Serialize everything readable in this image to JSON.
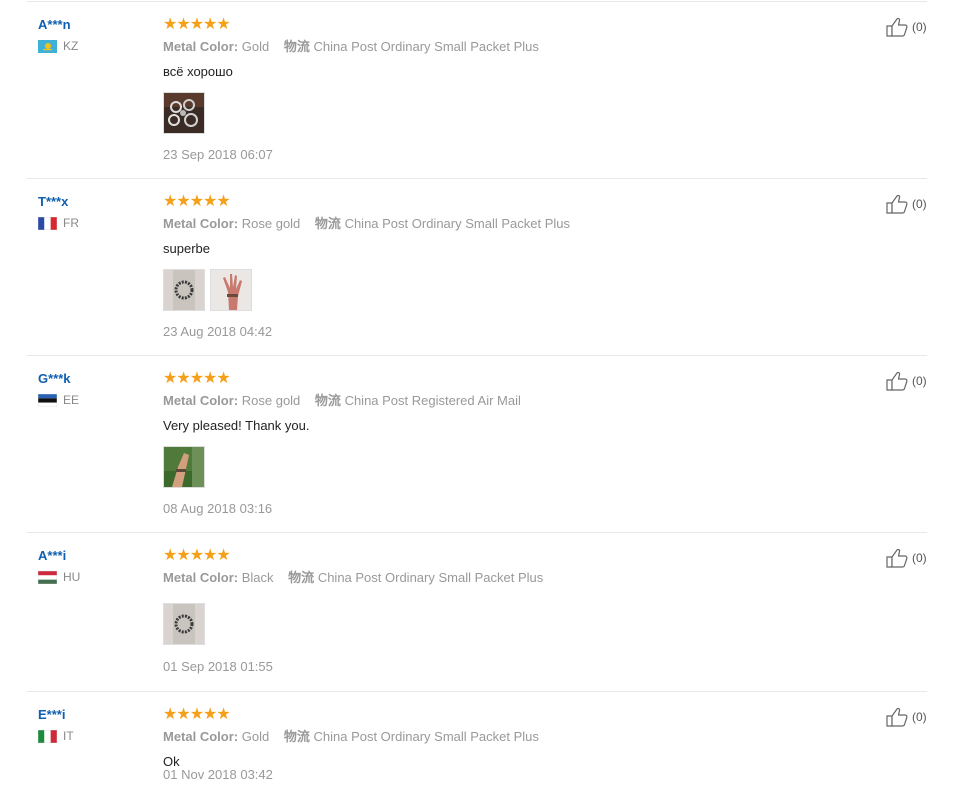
{
  "labels": {
    "metal_color": "Metal Color:",
    "logistics": "物流"
  },
  "stars": "★★★★★",
  "reviews": [
    {
      "user": "A***n",
      "country": "KZ",
      "flag_colors": [
        "#3fb0d8",
        "#f2c21a"
      ],
      "metal_color": "Gold",
      "logistics": "China Post Ordinary Small Packet Plus",
      "feedback": "всё хорошо",
      "photos": [
        "buyer-photo-bracelets"
      ],
      "date": "23 Sep 2018 06:07",
      "helpful": "(0)"
    },
    {
      "user": "T***x",
      "country": "FR",
      "flag_colors": [
        "#2b4aa8",
        "#ffffff",
        "#d7282f"
      ],
      "metal_color": "Rose gold",
      "logistics": "China Post Ordinary Small Packet Plus",
      "feedback": "superbe",
      "photos": [
        "buyer-photo-bracelet",
        "buyer-photo-hand"
      ],
      "date": "23 Aug 2018 04:42",
      "helpful": "(0)"
    },
    {
      "user": "G***k",
      "country": "EE",
      "flag_colors": [
        "#2a63b5",
        "#111111",
        "#ffffff"
      ],
      "metal_color": "Rose gold",
      "logistics": "China Post Registered Air Mail",
      "feedback": "Very pleased! Thank you.",
      "photos": [
        "buyer-photo-wrist"
      ],
      "date": "08 Aug 2018 03:16",
      "helpful": "(0)"
    },
    {
      "user": "A***i",
      "country": "HU",
      "flag_colors": [
        "#cd2a3e",
        "#ffffff",
        "#436f4d"
      ],
      "metal_color": "Black",
      "logistics": "China Post Ordinary Small Packet Plus",
      "feedback": "",
      "photos": [
        "buyer-photo-bracelet"
      ],
      "date": "01 Sep 2018 01:55",
      "helpful": "(0)"
    },
    {
      "user": "E***i",
      "country": "IT",
      "flag_colors": [
        "#1c8c3c",
        "#ffffff",
        "#ce2b37"
      ],
      "metal_color": "Gold",
      "logistics": "China Post Ordinary Small Packet Plus",
      "feedback": "Ok",
      "photos": [],
      "date": "01 Nov 2018 03:42",
      "helpful": "(0)"
    }
  ]
}
